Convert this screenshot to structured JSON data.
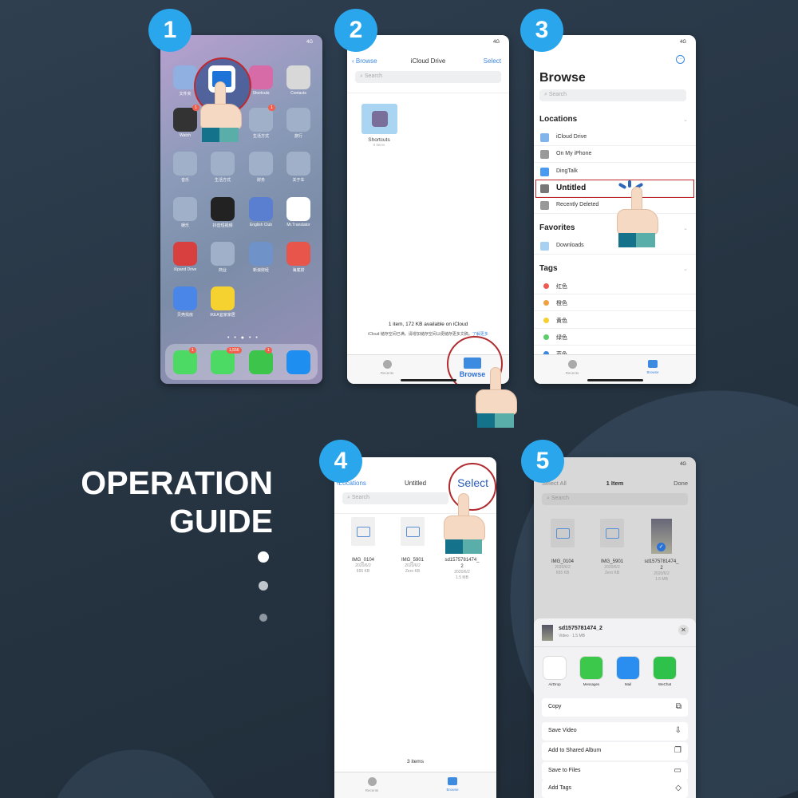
{
  "steps": [
    "1",
    "2",
    "3",
    "4",
    "5"
  ],
  "guide": {
    "line1": "OPERATION",
    "line2": "GUIDE"
  },
  "status": "4G",
  "colors": {
    "accent": "#2aa7ec",
    "ios_blue": "#3a86e0",
    "highlight_red": "#c0282e",
    "background": "#263442"
  },
  "phone1": {
    "apps": [
      {
        "label": "文件夹",
        "color": "#8fb0e0"
      },
      {
        "label": "",
        "color": "#1e73d8"
      },
      {
        "label": "Shortcuts",
        "color": "#d66ba8"
      },
      {
        "label": "Contacts",
        "color": "#d8d8d8"
      },
      {
        "label": "Watch",
        "color": "#333333",
        "badge": "1"
      },
      {
        "label": "",
        "color": "#9fb0c8"
      },
      {
        "label": "生活方式",
        "color": "#9fb0c8",
        "badge": "1"
      },
      {
        "label": "旅行",
        "color": "#9fb0c8"
      },
      {
        "label": "音乐",
        "color": "#9fb0c8"
      },
      {
        "label": "生活方式",
        "color": "#9fb0c8"
      },
      {
        "label": "财务",
        "color": "#9fb0c8"
      },
      {
        "label": "关于车",
        "color": "#9fb0c8"
      },
      {
        "label": "娱乐",
        "color": "#9fb0c8"
      },
      {
        "label": "抖音短视频",
        "color": "#222222"
      },
      {
        "label": "English Club",
        "color": "#5b7fd0"
      },
      {
        "label": "Mr.Translator",
        "color": "#ffffff"
      },
      {
        "label": "iXpand Drive",
        "color": "#d84040"
      },
      {
        "label": "商业",
        "color": "#9fb0c8"
      },
      {
        "label": "新浪财经",
        "color": "#6f92c8"
      },
      {
        "label": "海底捞",
        "color": "#e8554a"
      },
      {
        "label": "贝壳找房",
        "color": "#4a86e8"
      },
      {
        "label": "IKEA宜家家居",
        "color": "#f5d230"
      }
    ],
    "dock": [
      {
        "label": "phone",
        "color": "#4cd964",
        "badge": "1"
      },
      {
        "label": "messages",
        "color": "#4cd964",
        "badge": "1,556"
      },
      {
        "label": "wechat",
        "color": "#3cc54a",
        "badge": "1"
      },
      {
        "label": "alipay",
        "color": "#1e8ff0"
      }
    ]
  },
  "phone2": {
    "back": "Browse",
    "title": "iCloud Drive",
    "select": "Select",
    "search": "Search",
    "folder": {
      "name": "Shortcuts",
      "count": "0 items"
    },
    "footer": "1 item, 172 KB available on iCloud",
    "notice": "iCloud 储存空间已满。请增加储存空间以便储存更多文稿。",
    "notice_link": "了解更多",
    "tabs": {
      "recents": "Recents",
      "browse": "Browse"
    }
  },
  "phone3": {
    "title": "Browse",
    "search": "Search",
    "locations_header": "Locations",
    "locations": [
      {
        "label": "iCloud Drive",
        "color": "#7fb5ea"
      },
      {
        "label": "On My iPhone",
        "color": "#999999"
      },
      {
        "label": "DingTalk",
        "color": "#4a9af0"
      },
      {
        "label": "Untitled",
        "color": "#777777"
      },
      {
        "label": "Recently Deleted",
        "color": "#999999"
      }
    ],
    "favorites_header": "Favorites",
    "favorites": [
      {
        "label": "Downloads",
        "color": "#a8d0f0"
      }
    ],
    "tags_header": "Tags",
    "tags": [
      {
        "label": "红色",
        "color": "#ee5a52"
      },
      {
        "label": "橙色",
        "color": "#f0a040"
      },
      {
        "label": "黄色",
        "color": "#f5d030"
      },
      {
        "label": "绿色",
        "color": "#5ccc6a"
      },
      {
        "label": "蓝色",
        "color": "#3a86e0"
      }
    ],
    "tabs": {
      "recents": "Recents",
      "browse": "Browse"
    }
  },
  "files": [
    {
      "name": "IMG_0104",
      "date": "2020/6/2",
      "size": "655 KB"
    },
    {
      "name": "IMG_5901",
      "date": "2020/6/2",
      "size": "Zero KB"
    },
    {
      "name": "sd1575781474_\n2",
      "date": "2020/6/2",
      "size": "1.5 MB"
    }
  ],
  "phone4": {
    "back": "Locations",
    "title": "Untitled",
    "select": "Select",
    "search": "Search",
    "count": "3 items",
    "tabs": {
      "recents": "Recents",
      "browse": "Browse"
    }
  },
  "phone5": {
    "select_all": "Select All",
    "title": "1 Item",
    "done": "Done",
    "search": "Search",
    "sheet": {
      "name": "sd1575781474_2",
      "meta": "Video · 1.5 MB"
    },
    "share_apps": [
      {
        "label": "AirDrop",
        "color": "#ffffff"
      },
      {
        "label": "Messages",
        "color": "#3cc84a"
      },
      {
        "label": "Mail",
        "color": "#2a8ef0"
      },
      {
        "label": "WeChat",
        "color": "#2fc24a"
      }
    ],
    "actions": [
      {
        "label": "Copy",
        "icon": "copy-icon",
        "glyph": "⧉"
      },
      {
        "label": "Save Video",
        "icon": "download-icon",
        "glyph": "⇩"
      },
      {
        "label": "Add to Shared Album",
        "icon": "shared-album-icon",
        "glyph": "❐"
      },
      {
        "label": "Save to Files",
        "icon": "folder-icon",
        "glyph": "▭"
      },
      {
        "label": "Add Tags",
        "icon": "tag-icon",
        "glyph": "◇"
      }
    ]
  }
}
